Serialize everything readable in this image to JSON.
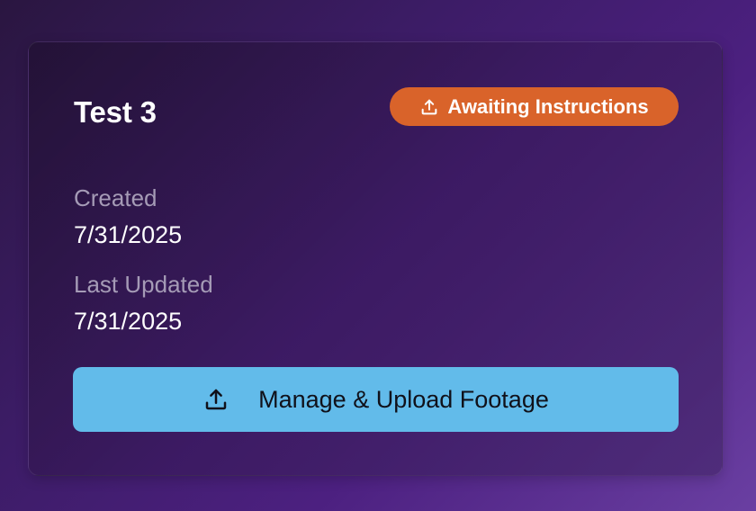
{
  "card": {
    "title": "Test 3",
    "status_badge": {
      "label": "Awaiting Instructions",
      "icon": "upload-icon",
      "color": "#d9632a"
    },
    "created": {
      "label": "Created",
      "value": "7/31/2025"
    },
    "last_updated": {
      "label": "Last Updated",
      "value": "7/31/2025"
    },
    "primary_action": {
      "label": "Manage & Upload Footage",
      "icon": "upload-icon",
      "color": "#62bbea"
    }
  }
}
